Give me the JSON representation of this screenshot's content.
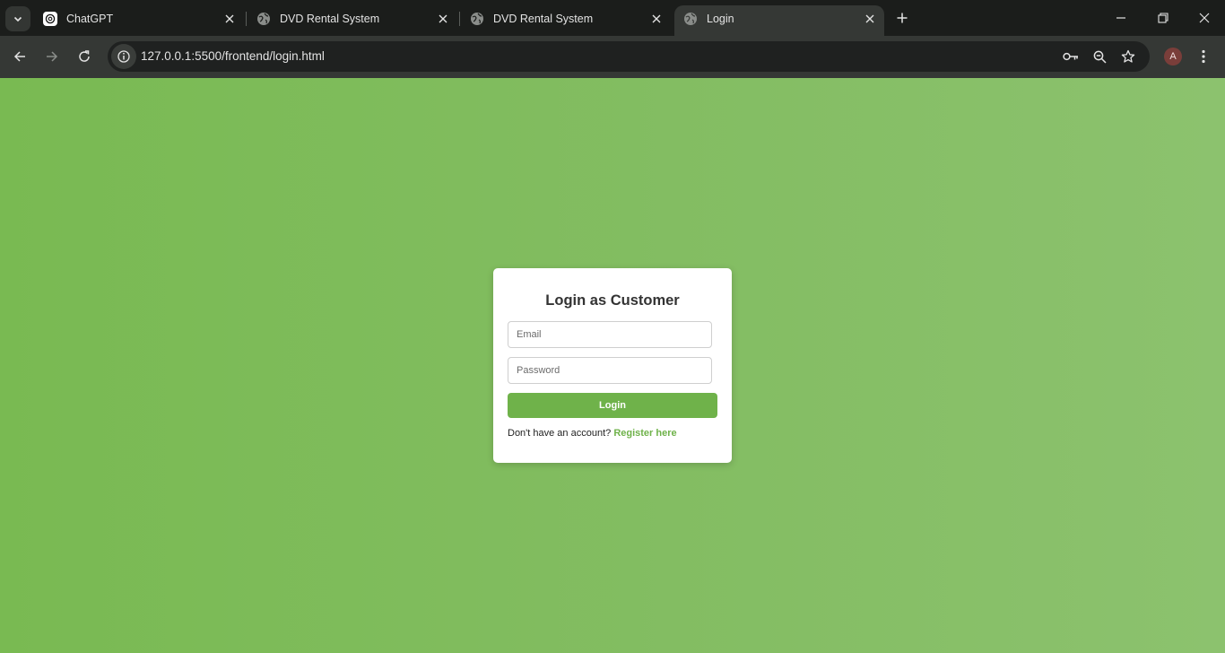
{
  "browser": {
    "tabs": [
      {
        "title": "ChatGPT",
        "favicon": "chatgpt-icon",
        "active": false
      },
      {
        "title": "DVD Rental System",
        "favicon": "globe-icon",
        "active": false
      },
      {
        "title": "DVD Rental System",
        "favicon": "globe-icon",
        "active": false
      },
      {
        "title": "Login",
        "favicon": "globe-icon",
        "active": true
      }
    ],
    "address": {
      "host": "127.0.0.1",
      "rest": ":5500/frontend/login.html"
    },
    "profile_initial": "A"
  },
  "login": {
    "heading": "Login as Customer",
    "email_placeholder": "Email",
    "email_value": "",
    "password_placeholder": "Password",
    "password_value": "",
    "button_label": "Login",
    "register_prompt": "Don't have an account?",
    "register_link": "Register here"
  },
  "colors": {
    "accent_green": "#6fb24a",
    "page_bg_left": "#79ba52",
    "page_bg_right": "#8cc26e"
  }
}
